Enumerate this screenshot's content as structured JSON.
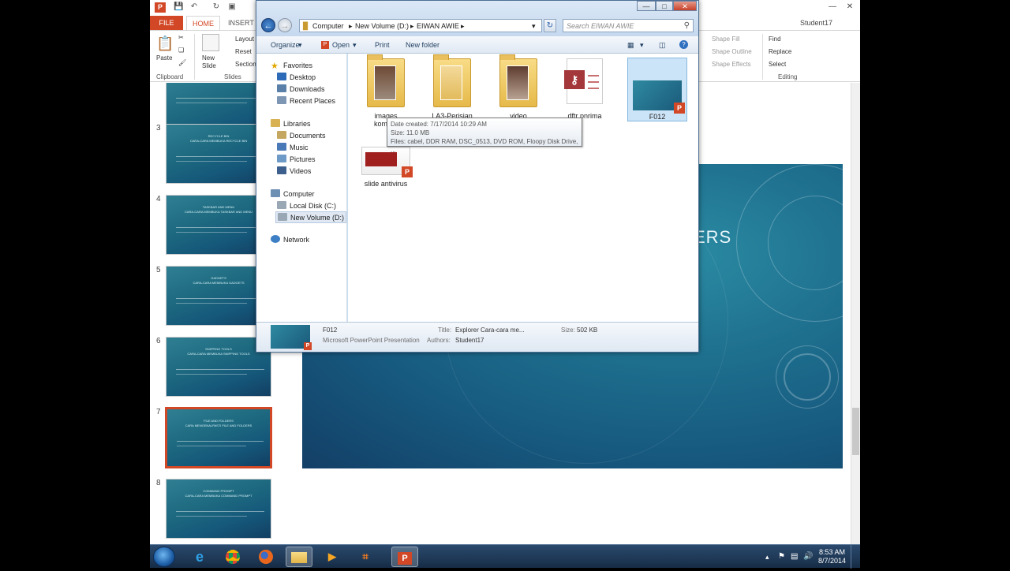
{
  "powerpoint": {
    "tabs": {
      "file": "FILE",
      "home": "HOME",
      "insert": "INSERT"
    },
    "user": "Student17",
    "ribbon": {
      "paste": "Paste",
      "new_slide": "New Slide",
      "layout": "Layout",
      "reset": "Reset",
      "section": "Section",
      "clipboard_label": "Clipboard",
      "slides_label": "Slides",
      "shape_fill": "Shape Fill",
      "shape_outline": "Shape Outline",
      "shape_effects": "Shape Effects",
      "find": "Find",
      "replace": "Replace",
      "select": "Select",
      "editing_label": "Editing"
    },
    "slides": [
      {
        "num": "",
        "title": ""
      },
      {
        "num": "3",
        "title": "RECYCLE BIN\nCARA-CARA MEMBUKA RECYCLE BIN"
      },
      {
        "num": "4",
        "title": "TASKBAR AND MENU\nCARA-CARA MEMBUKA TASKBAR AND MENU"
      },
      {
        "num": "5",
        "title": "GADGETS\nCARA-CARA MEMBUKA GADGETS"
      },
      {
        "num": "6",
        "title": "SNIPPING TOOLS\nCARA-CARA MEMBUKA SNIPPING TOOLS"
      },
      {
        "num": "7",
        "title": "FILE AND FOLDERS\nCARA MENGENALPASTI FILE AND FOLDERS"
      },
      {
        "num": "8",
        "title": "COMMAND PROMPT\nCARA-CARA MEMBUKA COMMAND PROMPT"
      }
    ],
    "main_slide_title_visible": "ERS"
  },
  "explorer": {
    "address": [
      "Computer",
      "New Volume (D:)",
      "EIWAN AWIE"
    ],
    "search_placeholder": "Search EIWAN AWIE",
    "toolbar": {
      "organize": "Organize",
      "open": "Open",
      "print": "Print",
      "new_folder": "New folder"
    },
    "nav": {
      "favorites": "Favorites",
      "desktop": "Desktop",
      "downloads": "Downloads",
      "recent": "Recent Places",
      "libraries": "Libraries",
      "documents": "Documents",
      "music": "Music",
      "pictures": "Pictures",
      "videos": "Videos",
      "computer": "Computer",
      "local_disk": "Local Disk (C:)",
      "new_volume": "New Volume (D:)",
      "network": "Network"
    },
    "files": [
      {
        "name": "images",
        "name2": "kompor"
      },
      {
        "name": "LA3-Perisian"
      },
      {
        "name": "video"
      },
      {
        "name": "dftr pnrima"
      },
      {
        "name": "F012"
      },
      {
        "name": "slide antivirus"
      }
    ],
    "tooltip": {
      "created": "Date created: 7/17/2014 10:29 AM",
      "size": "Size: 11.0 MB",
      "files": "Files: cabel, DDR RAM, DSC_0513, DVD ROM, Floopy Disk Drive, ..."
    },
    "details": {
      "name": "F012",
      "type": "Microsoft PowerPoint Presentation",
      "title_key": "Title:",
      "title_val": "Explorer Cara-cara me...",
      "authors_key": "Authors:",
      "authors_val": "Student17",
      "size_key": "Size:",
      "size_val": "502 KB"
    }
  },
  "taskbar": {
    "time": "8:53 AM",
    "date": "8/7/2014"
  }
}
